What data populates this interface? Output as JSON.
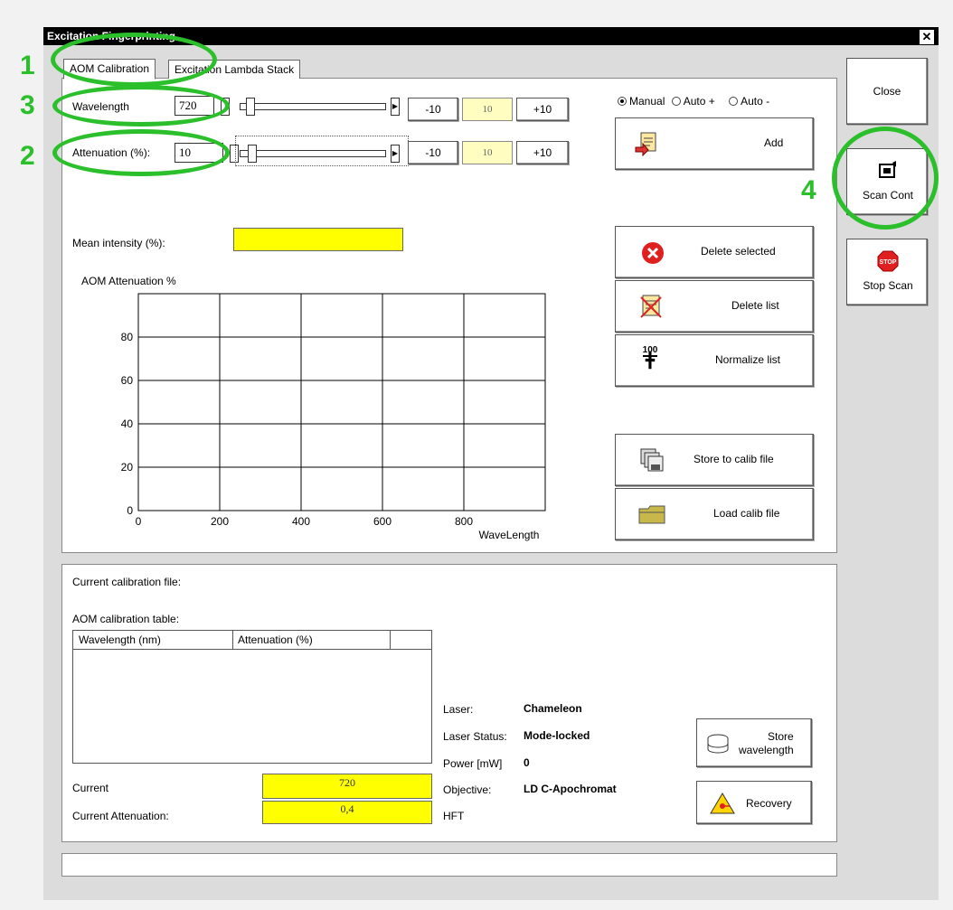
{
  "window": {
    "title": "Excitation Fingerprinting"
  },
  "tabs": [
    {
      "label": "AOM Calibration"
    },
    {
      "label": "Excitation Lambda Stack"
    }
  ],
  "annotations": [
    "1",
    "2",
    "3",
    "4"
  ],
  "wavelength": {
    "label": "Wavelength",
    "value": "720",
    "minus": "-10",
    "step": "10",
    "plus": "+10"
  },
  "attenuation": {
    "label": "Attenuation (%):",
    "value": "10",
    "minus": "-10",
    "step": "10",
    "plus": "+10"
  },
  "mode": {
    "manual": "Manual",
    "auto_plus": "Auto +",
    "auto_minus": "Auto -",
    "selected": "Manual"
  },
  "buttons": {
    "add": "Add",
    "delete_selected": "Delete selected",
    "delete_list": "Delete list",
    "normalize_list": "Normalize list",
    "normalize_icon_text": "100",
    "store_calib": "Store to calib file",
    "load_calib": "Load calib file",
    "store_wavelength_1": "Store",
    "store_wavelength_2": "wavelength",
    "recovery": "Recovery"
  },
  "side": {
    "close": "Close",
    "scan_cont": "Scan Cont",
    "stop_scan": "Stop Scan",
    "stop_icon_text": "STOP"
  },
  "mean_intensity": {
    "label": "Mean intensity (%):"
  },
  "chart_data": {
    "type": "line",
    "title": "AOM Attenuation %",
    "xlabel": "WaveLength",
    "ylabel": "",
    "xlim": [
      0,
      1000
    ],
    "ylim": [
      0,
      100
    ],
    "x_ticks": [
      0,
      200,
      400,
      600,
      800
    ],
    "y_ticks": [
      0,
      20,
      40,
      60,
      80
    ],
    "grid": true,
    "series": []
  },
  "calibration": {
    "current_file_label": "Current calibration file:",
    "table_label": "AOM calibration table:",
    "columns": [
      "Wavelength (nm)",
      "Attenuation (%)",
      ""
    ],
    "rows": [],
    "current_label": "Current",
    "current_value": "720",
    "current_att_label": "Current Attenuation:",
    "current_att_value": "0,4"
  },
  "laser_info": {
    "laser_label": "Laser:",
    "laser_value": "Chameleon",
    "status_label": "Laser Status:",
    "status_value": "Mode-locked",
    "power_label": "Power [mW]",
    "power_value": "0",
    "objective_label": "Objective:",
    "objective_value": "LD C-Apochromat",
    "hft_label": "HFT",
    "hft_value": ""
  },
  "colors": {
    "highlight": "#ffff00",
    "annotation": "#2bc02b"
  }
}
